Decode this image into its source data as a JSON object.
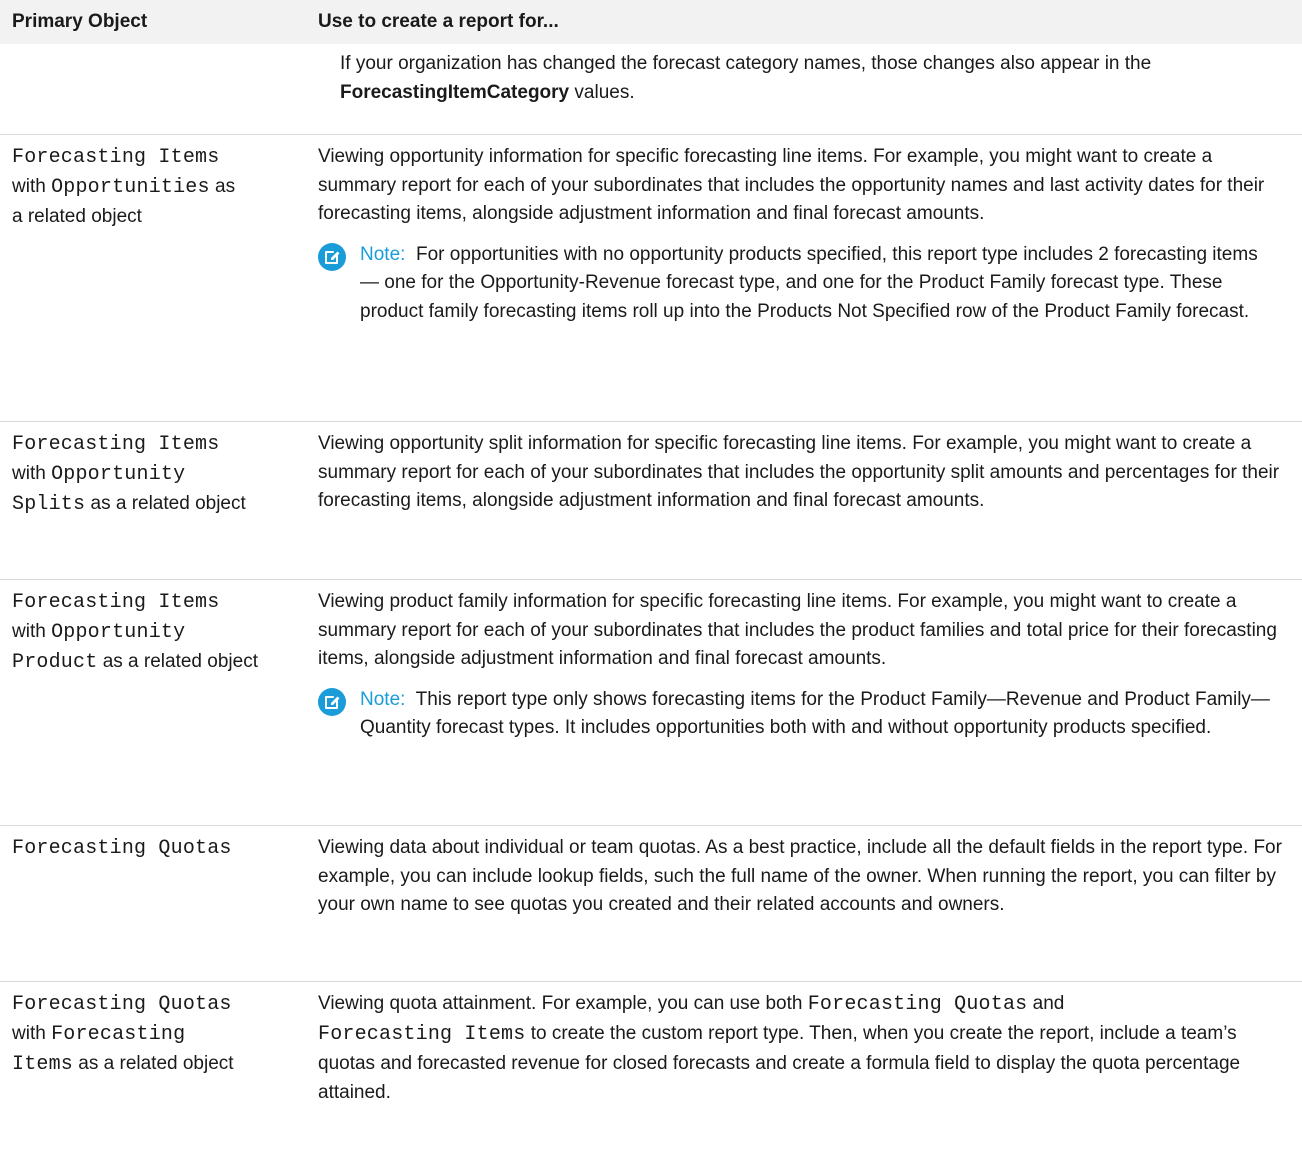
{
  "headers": {
    "primary_object": "Primary Object",
    "use_for": "Use to create a report for..."
  },
  "row0": {
    "text_before": "If your organization has changed the forecast category names, those changes also appear in the ",
    "bold": "ForecastingItemCategory",
    "text_after": " values."
  },
  "row1": {
    "obj_mono1": "Forecasting Items",
    "obj_sans1": "with",
    "obj_mono2": "Opportunities",
    "obj_sans2": "as",
    "obj_sans3": "a related object",
    "desc": "Viewing opportunity information for specific forecasting line items. For example, you might want to create a summary report for each of your subordinates that includes the opportunity names and last activity dates for their forecasting items, alongside adjustment information and final forecast amounts.",
    "note_label": "Note:",
    "note_text": "For opportunities with no opportunity products specified, this report type includes 2 forecasting items — one for the Opportunity-Revenue forecast type, and one for the Product Family forecast type. These product family forecasting items roll up into the Products Not Specified row of the Product Family forecast."
  },
  "row2": {
    "obj_mono1": "Forecasting Items",
    "obj_sans1": "with",
    "obj_mono2": "Opportunity",
    "obj_mono3": "Splits",
    "obj_sans2": "as a related object",
    "desc": "Viewing opportunity split information for specific forecasting line items. For example, you might want to create a summary report for each of your subordinates that includes the opportunity split amounts and percentages for their forecasting items, alongside adjustment information and final forecast amounts."
  },
  "row3": {
    "obj_mono1": "Forecasting Items",
    "obj_sans1": "with",
    "obj_mono2": "Opportunity",
    "obj_mono3": "Product",
    "obj_sans2": "as a related object",
    "desc": "Viewing product family information for specific forecasting line items. For example, you might want to create a summary report for each of your subordinates that includes the product families and total price for their forecasting items, alongside adjustment information and final forecast amounts.",
    "note_label": "Note:",
    "note_text": "This report type only shows forecasting items for the Product Family—Revenue and Product Family—Quantity forecast types. It includes opportunities both with and without opportunity products specified."
  },
  "row4": {
    "obj_mono1": "Forecasting Quotas",
    "desc": "Viewing data about individual or team quotas. As a best practice, include all the default fields in the report type. For example, you can include lookup fields, such the full name of the owner. When running the report, you can filter by your own name to see quotas you created and their related accounts and owners."
  },
  "row5": {
    "obj_mono1": "Forecasting Quotas",
    "obj_sans1": "with",
    "obj_mono2": "Forecasting",
    "obj_mono3": "Items",
    "obj_sans2": "as a related object",
    "desc_1": "Viewing quota attainment. For example, you can use both ",
    "desc_mono1": "Forecasting Quotas",
    "desc_2": " and ",
    "desc_mono2": "Forecasting Items",
    "desc_3": " to create the custom report type. Then, when you create the report, include a team’s quotas and forecasted revenue for closed forecasts and create a formula field to display the quota percentage attained."
  },
  "colors": {
    "note_accent": "#1a9cd8",
    "header_bg": "#f2f2f2",
    "divider": "#d9d9d9"
  },
  "icons": {
    "note": "note-edit-icon"
  }
}
